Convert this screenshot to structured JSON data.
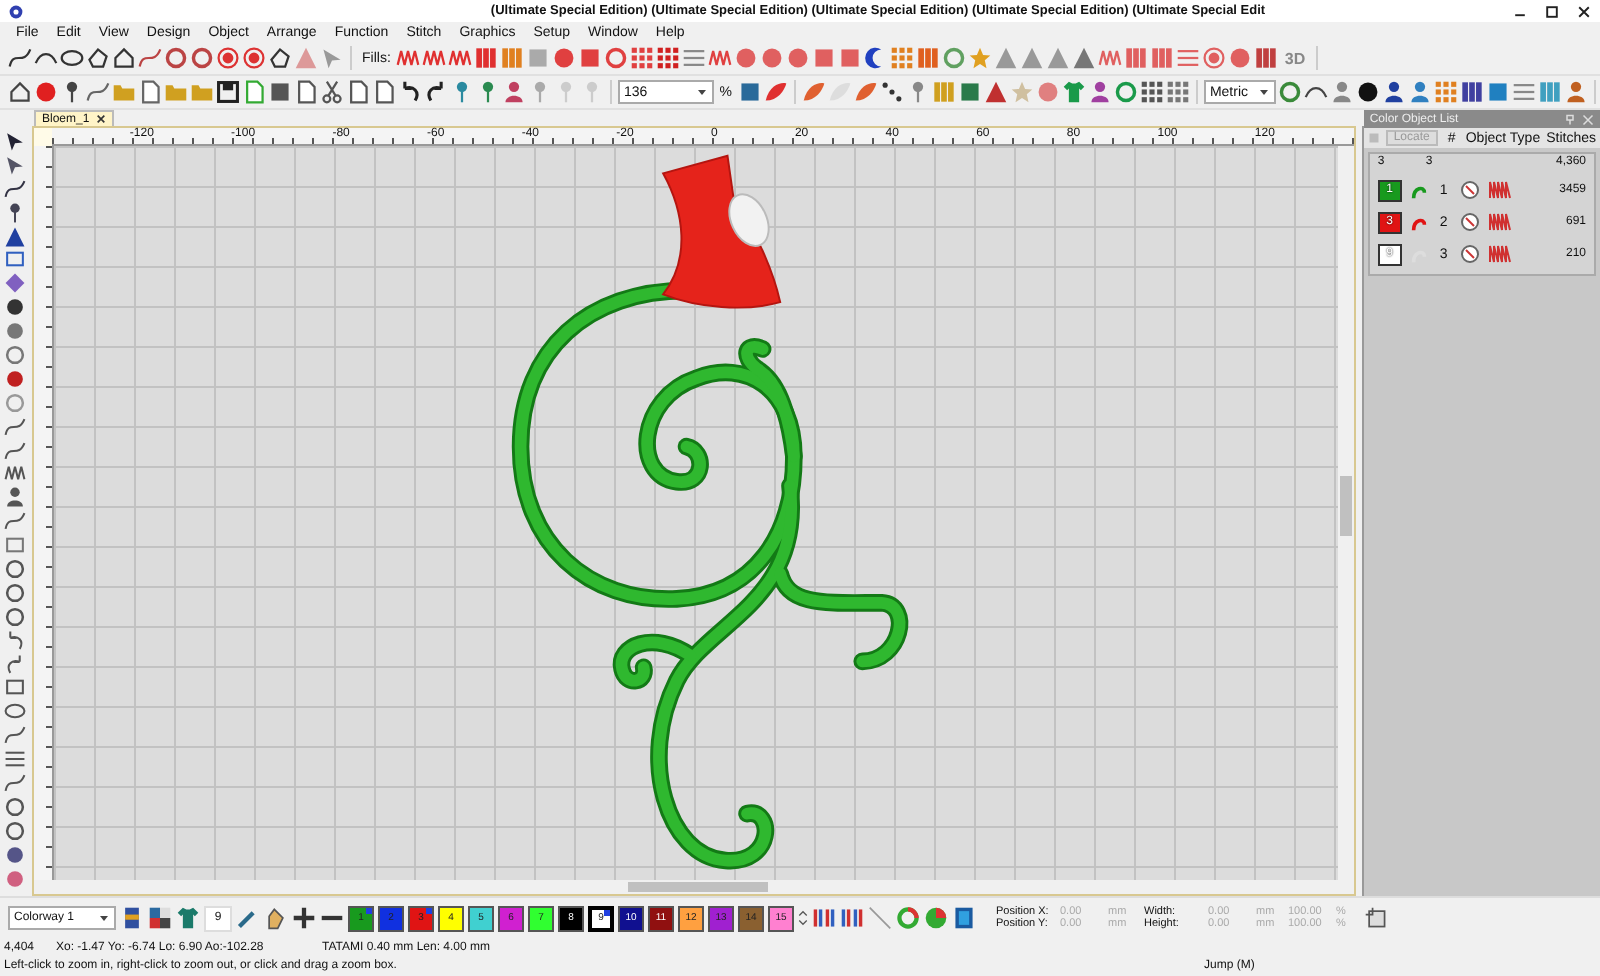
{
  "window": {
    "title": "(Ultimate Special Edition) (Ultimate Special Edition) (Ultimate Special Edition) (Ultimate Special Edition) (Ultimate Special Edit"
  },
  "menu": [
    "File",
    "Edit",
    "View",
    "Design",
    "Object",
    "Arrange",
    "Function",
    "Stitch",
    "Graphics",
    "Setup",
    "Window",
    "Help"
  ],
  "toolbar": {
    "fills_label": "Fills:",
    "label_3d": "3D",
    "zoom": "136",
    "zoom_unit": "%",
    "units": "Metric"
  },
  "document_tab": {
    "title": "Bloem_1",
    "selected": true
  },
  "ruler": {
    "labels": [
      "-120",
      "-100",
      "-80",
      "-60",
      "-40",
      "-20",
      "0",
      "20",
      "40",
      "60",
      "80",
      "100",
      "120"
    ]
  },
  "object_list": {
    "title": "Color Object List",
    "locate_button": "Locate",
    "columns": [
      "#",
      "Object Type",
      "Stitches"
    ],
    "summary": {
      "colors": "3",
      "objects": "3",
      "stitches": "4,360"
    },
    "rows": [
      {
        "color_number": "1",
        "color": "#189a1e",
        "number": "1",
        "stitches": "3459"
      },
      {
        "color_number": "3",
        "color": "#e01414",
        "number": "2",
        "stitches": "691"
      },
      {
        "color_number": "9",
        "color": "#ffffff",
        "number": "3",
        "stitches": "210"
      }
    ]
  },
  "bottom_toolbar": {
    "colorway": "Colorway 1",
    "needle": "9",
    "swatches": [
      {
        "label": "1",
        "color": "#189a1e",
        "used": true,
        "selected": false
      },
      {
        "label": "2",
        "color": "#1030e0",
        "used": false,
        "selected": false
      },
      {
        "label": "3",
        "color": "#e01414",
        "used": true,
        "selected": false
      },
      {
        "label": "4",
        "color": "#ffff00",
        "used": false,
        "selected": false
      },
      {
        "label": "5",
        "color": "#40d0d0",
        "used": false,
        "selected": false
      },
      {
        "label": "6",
        "color": "#d020d0",
        "used": false,
        "selected": false
      },
      {
        "label": "7",
        "color": "#30ff30",
        "used": false,
        "selected": false
      },
      {
        "label": "8",
        "color": "#000000",
        "used": false,
        "selected": false
      },
      {
        "label": "9",
        "color": "#ffffff",
        "used": true,
        "selected": true
      },
      {
        "label": "10",
        "color": "#101090",
        "used": false,
        "selected": false
      },
      {
        "label": "11",
        "color": "#901010",
        "used": false,
        "selected": false
      },
      {
        "label": "12",
        "color": "#ffa040",
        "used": false,
        "selected": false
      },
      {
        "label": "13",
        "color": "#a020d0",
        "used": false,
        "selected": false
      },
      {
        "label": "14",
        "color": "#8a6030",
        "used": false,
        "selected": false
      },
      {
        "label": "15",
        "color": "#ff80d0",
        "used": false,
        "selected": false
      }
    ],
    "fields": [
      {
        "label": "Position X:",
        "value": "0.00",
        "unit": "mm",
        "disabled": true
      },
      {
        "label": "Width:",
        "value": "0.00",
        "unit": "mm",
        "scale": "100.00",
        "disabled": true
      },
      {
        "label": "Position Y:",
        "value": "0.00",
        "unit": "mm",
        "disabled": true
      },
      {
        "label": "Height:",
        "value": "0.00",
        "unit": "mm",
        "scale": "100.00",
        "disabled": true
      }
    ],
    "scale_unit": "%"
  },
  "status": {
    "count": "4,404",
    "coords": "Xo: -1.47 Yo: -6.74 Lo: 6.90 Ao:-102.28",
    "stitch_info": "TATAMI 0.40 mm Len: 4.00 mm",
    "hint": "Left-click to zoom in, right-click to zoom out, or click and drag a zoom box.",
    "mode": "Jump (M)"
  }
}
